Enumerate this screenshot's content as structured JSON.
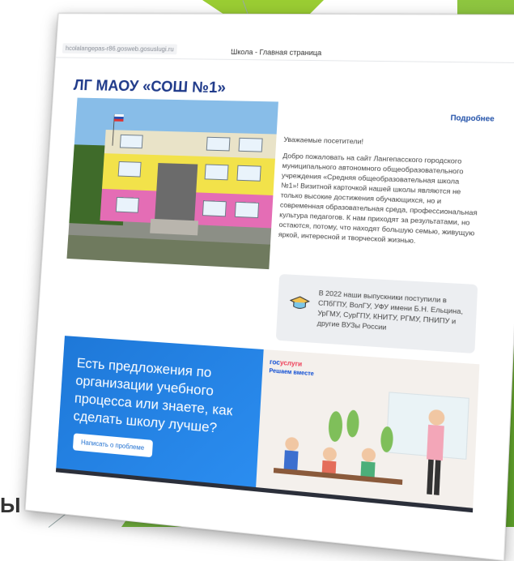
{
  "browser": {
    "url": "hcolalangepas-r86.gosweb.gosuslugi.ru",
    "tab_title": "Школа - Главная страница"
  },
  "header": {
    "school_name": "ЛГ МАОУ «СОШ №1»",
    "more_link": "Подробнее"
  },
  "intro": {
    "greeting": "Уважаемые посетители!",
    "body": "Добро пожаловать на сайт Лангепасского городского муниципального автономного общеобразовательного учреждения «Средняя общеобразовательная школа №1»! Визитной карточкой нашей школы являются не только высокие достижения обучающихся, но и современная образовательная среда, профессиональная культура педагогов. К нам приходят за результатами, но остаются, потому, что находят большую семью, живущую яркой, интересной и творческой жизнью."
  },
  "achievement": {
    "icon": "graduation-cap-icon",
    "text": "В 2022 наши выпускники поступили в СПбГПУ, ВолГУ, УФУ имени Б.Н. Ельцина, УрГМУ, СурГПУ, КНИТУ, РГМУ, ПНИПУ и другие ВУЗы России"
  },
  "promo": {
    "headline": "Есть предложения по организации учебного процесса или знаете, как сделать школу лучше?",
    "button": "Написать о проблеме",
    "brand_part1": "гос",
    "brand_part2": "услуги",
    "brand_sub": "Решаем вместе"
  },
  "colors": {
    "title_blue": "#1f3a8a",
    "promo_blue": "#1e78d8",
    "green_background": "#8ec63f"
  }
}
